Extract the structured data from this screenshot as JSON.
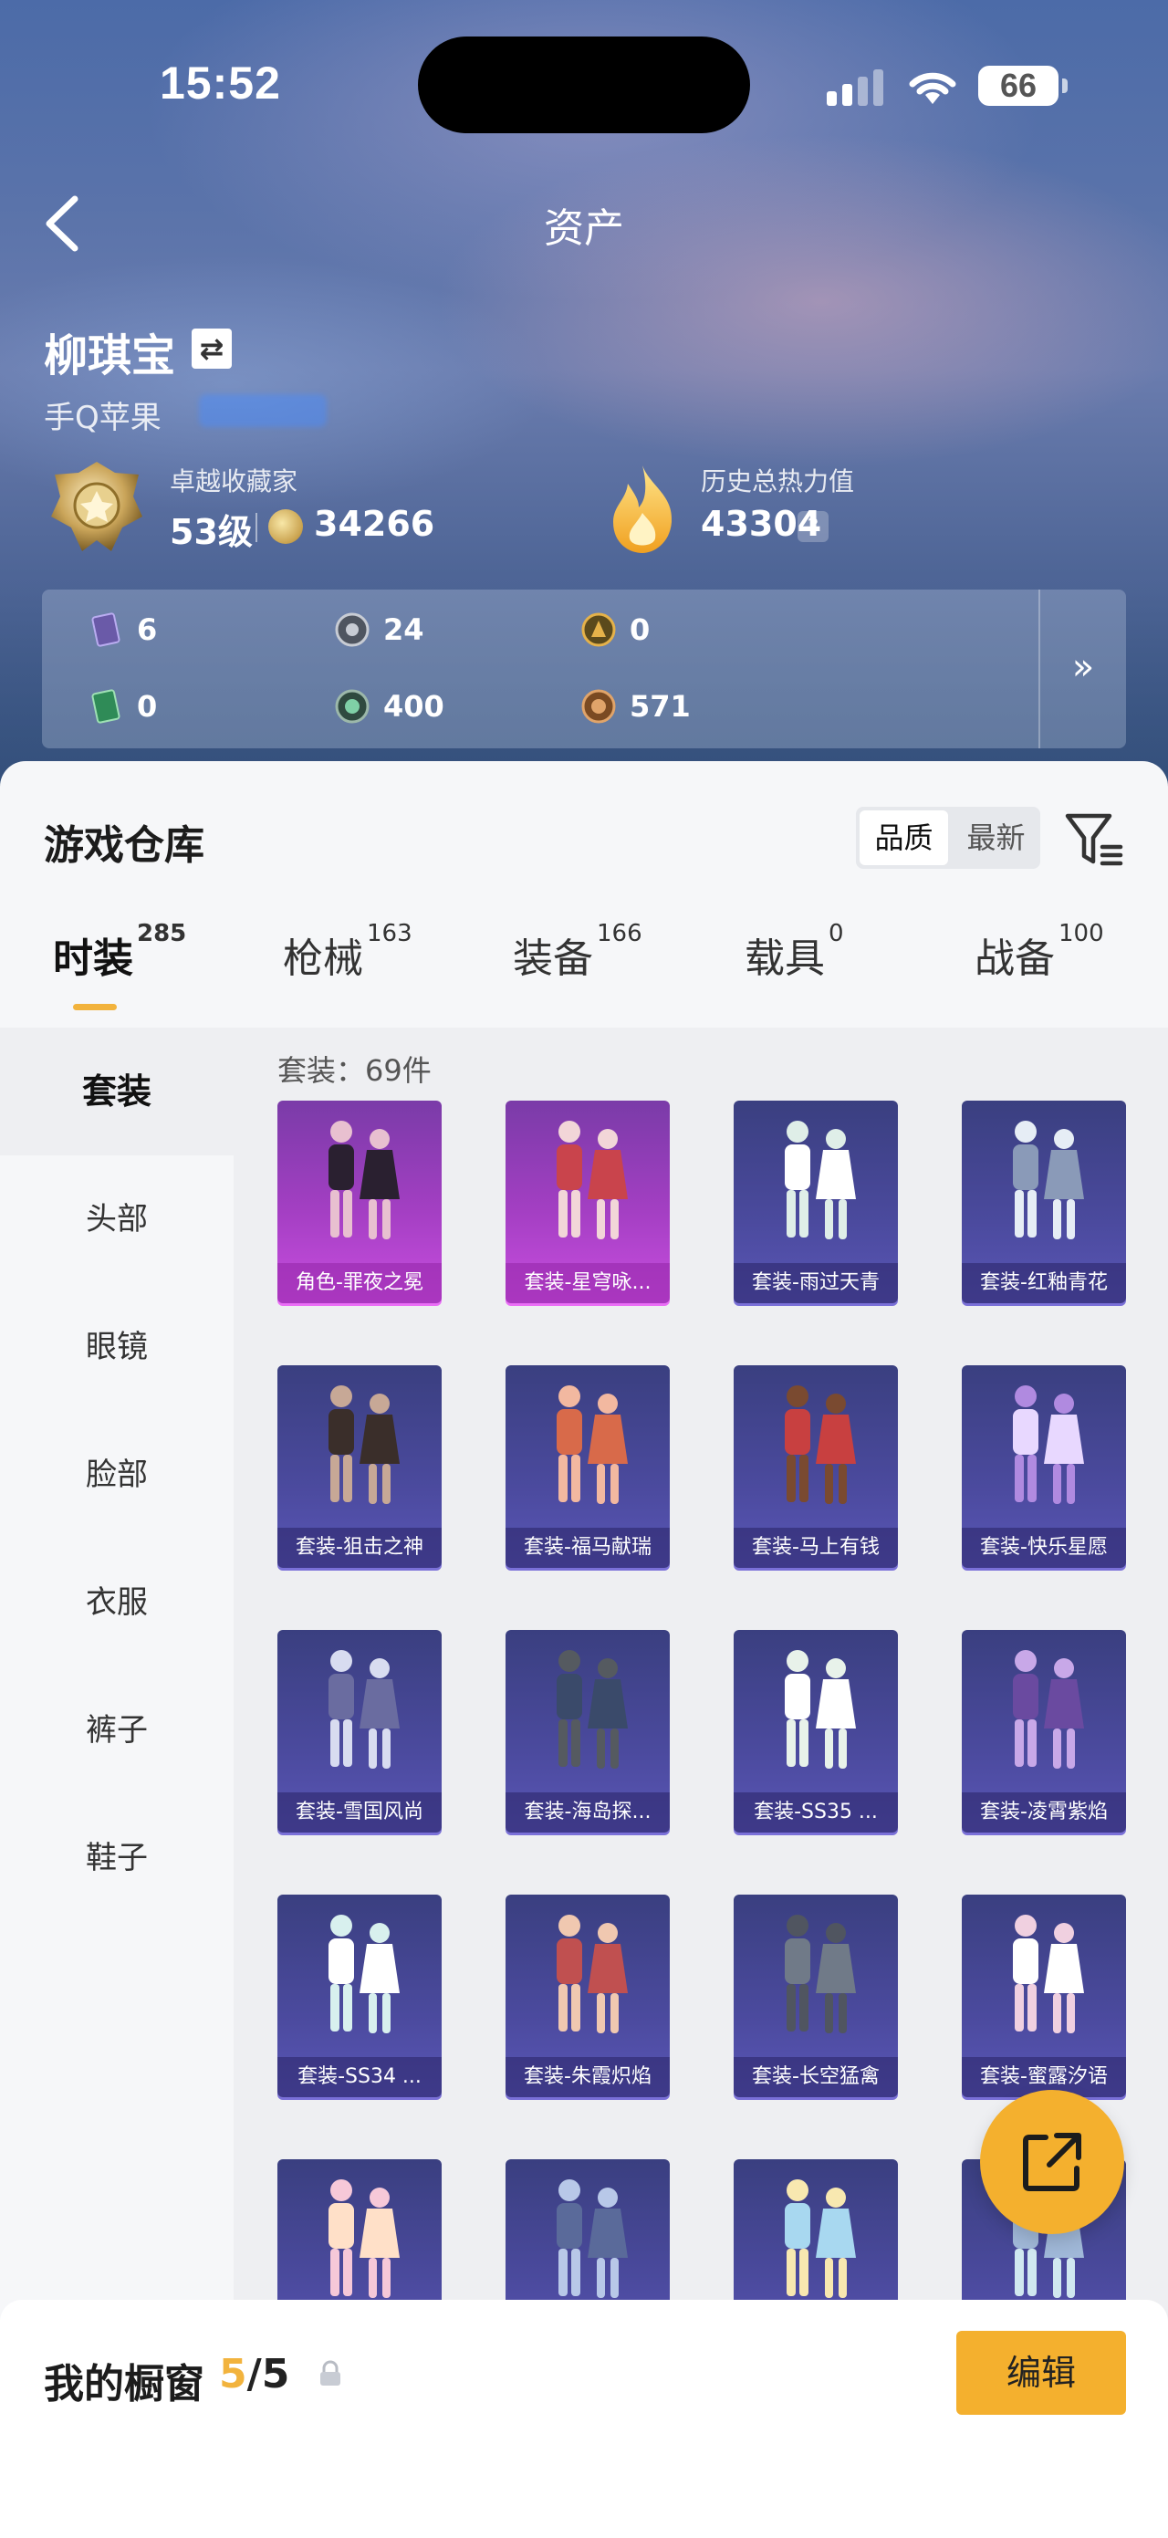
{
  "status": {
    "time": "15:52",
    "battery": "66"
  },
  "nav": {
    "title": "资产"
  },
  "profile": {
    "name": "柳琪宝",
    "platform": "手Q苹果"
  },
  "collector": {
    "title": "卓越收藏家",
    "level": "53级",
    "points": "34266"
  },
  "heat": {
    "title": "历史总热力值",
    "value": "43304",
    "help": "?"
  },
  "currencies": [
    {
      "icon": "purple-card-icon",
      "value": "6"
    },
    {
      "icon": "silver-coin-icon",
      "value": "24"
    },
    {
      "icon": "gold-token-icon",
      "value": "0"
    },
    {
      "icon": "green-card-icon",
      "value": "0"
    },
    {
      "icon": "green-orb-icon",
      "value": "400"
    },
    {
      "icon": "bronze-coin-icon",
      "value": "571"
    }
  ],
  "warehouse": {
    "title": "游戏仓库",
    "sort_quality": "品质",
    "sort_latest": "最新"
  },
  "tabs": [
    {
      "label": "时装",
      "count": "285"
    },
    {
      "label": "枪械",
      "count": "163"
    },
    {
      "label": "装备",
      "count": "166"
    },
    {
      "label": "载具",
      "count": "0"
    },
    {
      "label": "战备",
      "count": "100"
    }
  ],
  "sidebar": [
    "套装",
    "头部",
    "眼镜",
    "脸部",
    "衣服",
    "裤子",
    "鞋子"
  ],
  "count_label": "套装：69件",
  "items": [
    {
      "label": "角色-罪夜之冕",
      "rarity": "purple"
    },
    {
      "label": "套装-星穹咏...",
      "rarity": "purple"
    },
    {
      "label": "套装-雨过天青",
      "rarity": "blue"
    },
    {
      "label": "套装-红釉青花",
      "rarity": "blue"
    },
    {
      "label": "套装-狙击之神",
      "rarity": "blue"
    },
    {
      "label": "套装-福马献瑞",
      "rarity": "blue"
    },
    {
      "label": "套装-马上有钱",
      "rarity": "blue"
    },
    {
      "label": "套装-快乐星愿",
      "rarity": "blue"
    },
    {
      "label": "套装-雪国风尚",
      "rarity": "blue"
    },
    {
      "label": "套装-海岛探...",
      "rarity": "blue"
    },
    {
      "label": "套装-SS35 ...",
      "rarity": "blue"
    },
    {
      "label": "套装-凌霄紫焰",
      "rarity": "blue"
    },
    {
      "label": "套装-SS34 ...",
      "rarity": "blue"
    },
    {
      "label": "套装-朱霞炽焰",
      "rarity": "blue"
    },
    {
      "label": "套装-长空猛禽",
      "rarity": "blue"
    },
    {
      "label": "套装-蜜露汐语",
      "rarity": "blue"
    },
    {
      "label": "",
      "rarity": "blue"
    },
    {
      "label": "",
      "rarity": "blue"
    },
    {
      "label": "",
      "rarity": "blue"
    },
    {
      "label": "",
      "rarity": "blue"
    }
  ],
  "showcase": {
    "label": "我的橱窗",
    "current": "5",
    "total": "/5",
    "edit": "编辑"
  },
  "colors": {
    "accent": "#f4b02e",
    "rare_purple": "#c94ee0",
    "rare_blue": "#4b4a9e"
  }
}
